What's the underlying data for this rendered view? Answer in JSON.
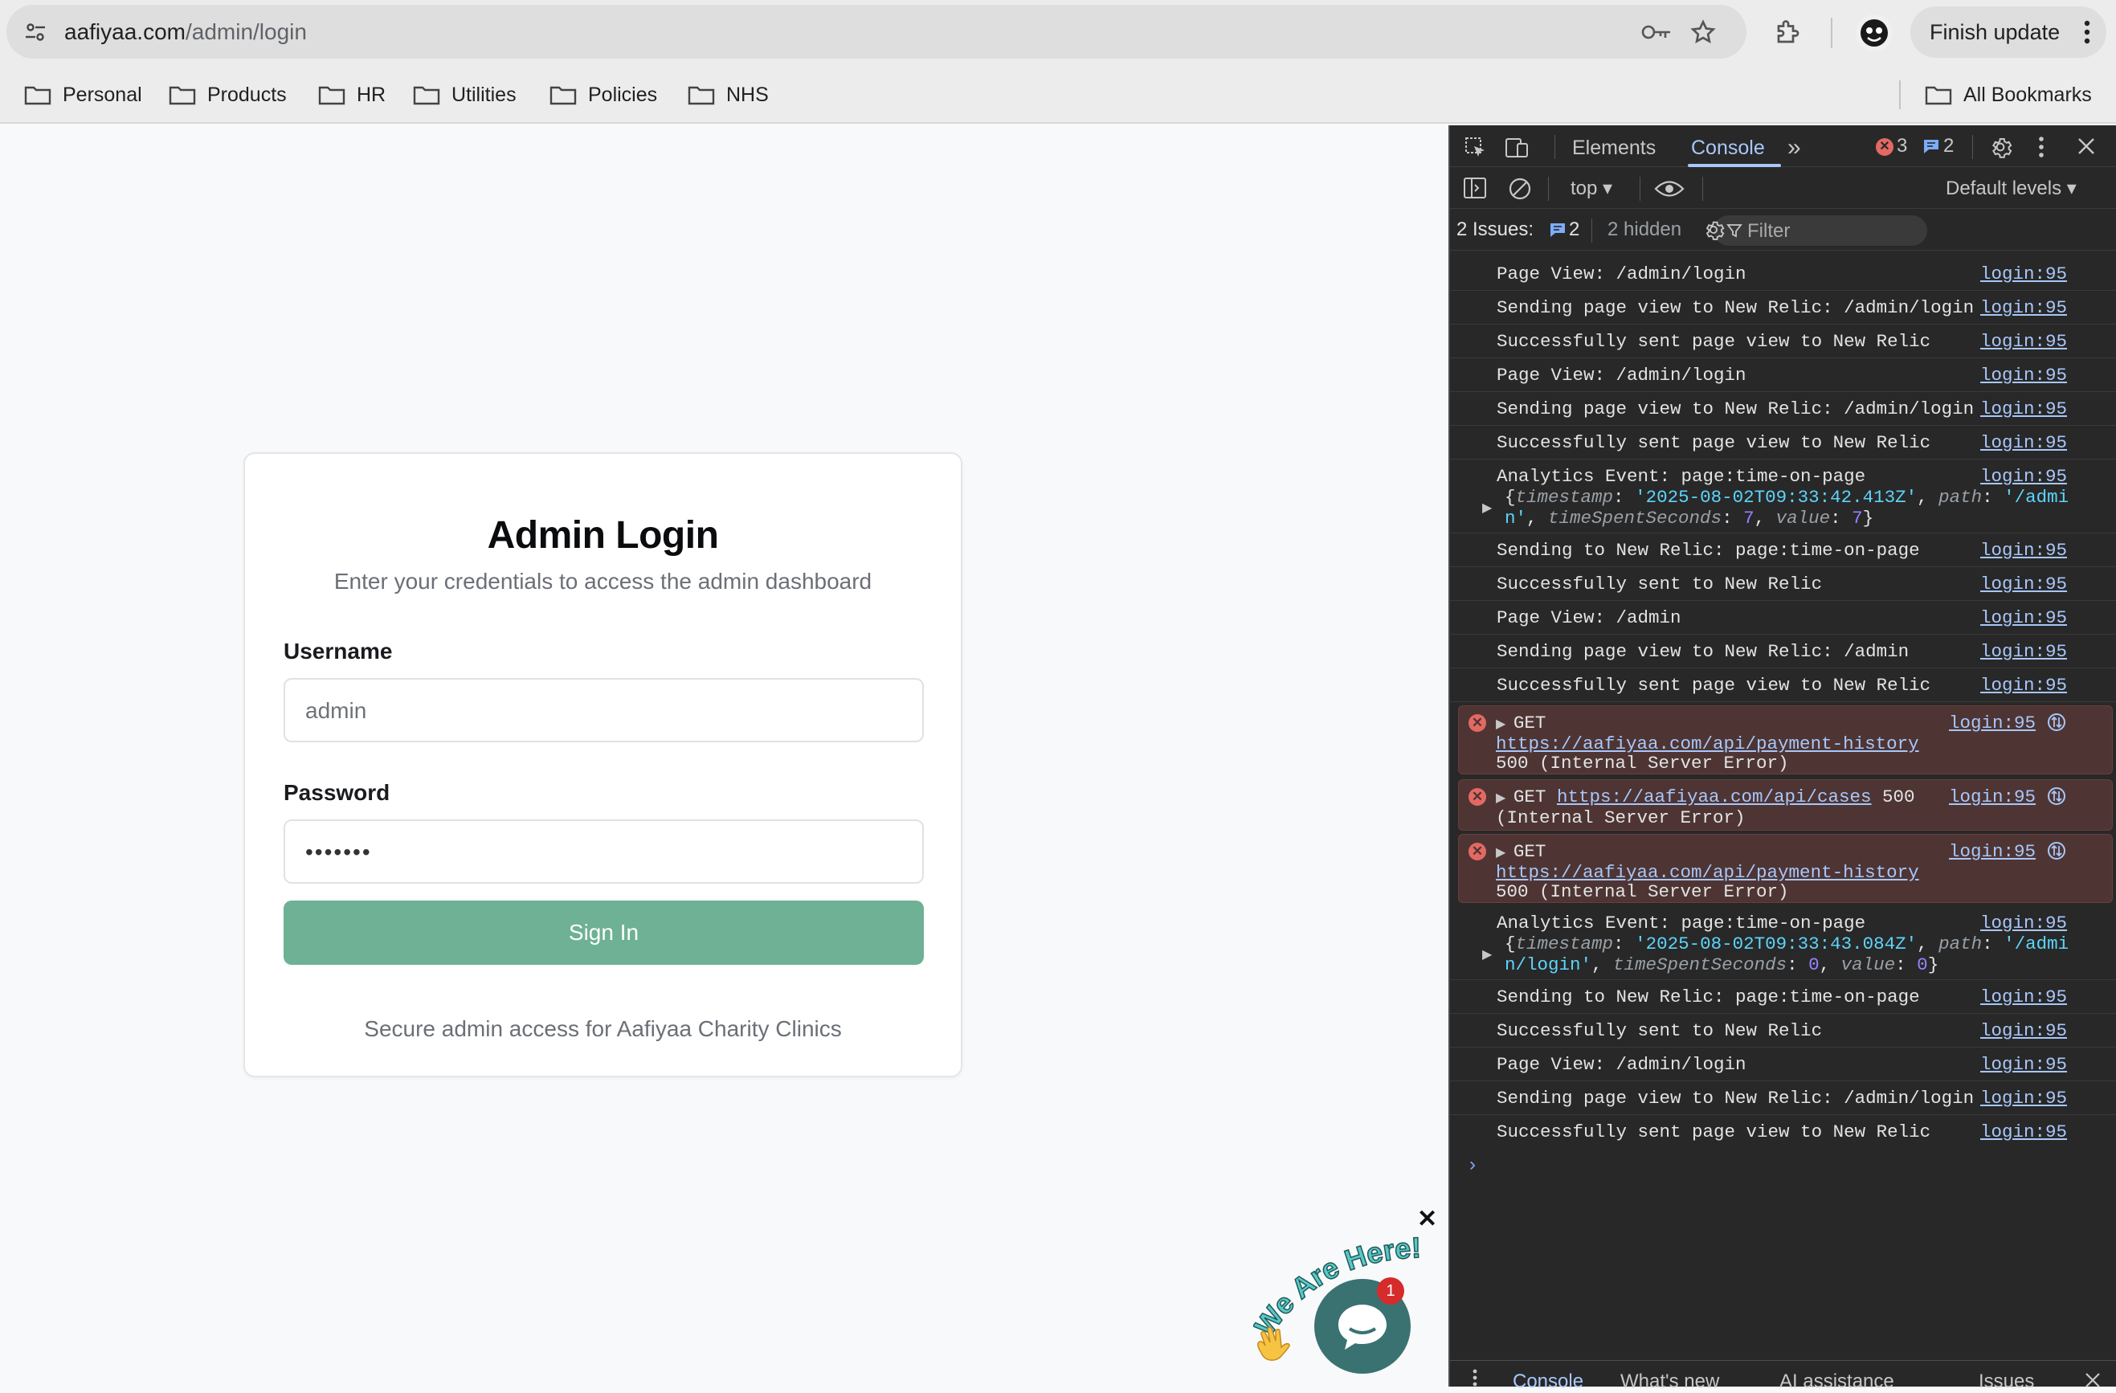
{
  "browser": {
    "url_domain": "aafiyaa.com",
    "url_path": "/admin/login",
    "finish_update_label": "Finish update",
    "bookmarks": [
      "Personal",
      "Products",
      "HR",
      "Utilities",
      "Policies",
      "NHS"
    ],
    "all_bookmarks_label": "All Bookmarks"
  },
  "login": {
    "title": "Admin Login",
    "subtitle": "Enter your credentials to access the admin dashboard",
    "username_label": "Username",
    "username_value": "admin",
    "password_label": "Password",
    "password_value": "•••••••",
    "signin_label": "Sign In",
    "footer": "Secure admin access for Aafiyaa Charity Clinics"
  },
  "chat": {
    "banner_text": "We Are Here!",
    "badge_count": "1",
    "close_glyph": "✕"
  },
  "devtools": {
    "tabs": [
      "Elements",
      "Console"
    ],
    "more_tabs_glyph": "»",
    "error_count": "3",
    "message_count": "2",
    "context": "top",
    "filter_placeholder": "Filter",
    "levels": "Default levels",
    "issues_label": "2 Issues:",
    "issues_count": "2",
    "hidden_label": "2 hidden",
    "source": "login:95",
    "logs": [
      "Page View: /admin/login",
      "Sending page view to New Relic: /admin/login",
      "Successfully sent page view to New Relic",
      "Page View: /admin/login",
      "Sending page view to New Relic: /admin/login",
      "Successfully sent page view to New Relic"
    ],
    "analytics1": {
      "label": "Analytics Event: page:time-on-page",
      "timestamp": "'2025-08-02T09:33:42.413Z'",
      "path_part1": "'/admi",
      "path_part2": "n'",
      "time_spent": "7",
      "value": "7"
    },
    "logs2": [
      "Sending to New Relic: page:time-on-page",
      "Successfully sent to New Relic",
      "Page View: /admin",
      "Sending page view to New Relic: /admin",
      "Successfully sent page view to New Relic"
    ],
    "errors": [
      {
        "method": "GET",
        "url": "https://aafiyaa.com/api/payment-history",
        "status": "500 (Internal Server Error)"
      },
      {
        "method": "GET",
        "url": "https://aafiyaa.com/api/cases",
        "status_a": "500",
        "status_b": "(Internal Server Error)"
      },
      {
        "method": "GET",
        "url": "https://aafiyaa.com/api/payment-history",
        "status": "500 (Internal Server Error)"
      }
    ],
    "analytics2": {
      "label": "Analytics Event: page:time-on-page",
      "timestamp": "'2025-08-02T09:33:43.084Z'",
      "path_part1": "'/admi",
      "path_part2": "n/login'",
      "time_spent": "0",
      "value": "0"
    },
    "logs3": [
      "Sending to New Relic: page:time-on-page",
      "Successfully sent to New Relic",
      "Page View: /admin/login",
      "Sending page view to New Relic: /admin/login",
      "Successfully sent page view to New Relic"
    ],
    "bottom_tabs": [
      "Console",
      "What's new",
      "AI assistance",
      "Issues"
    ]
  }
}
